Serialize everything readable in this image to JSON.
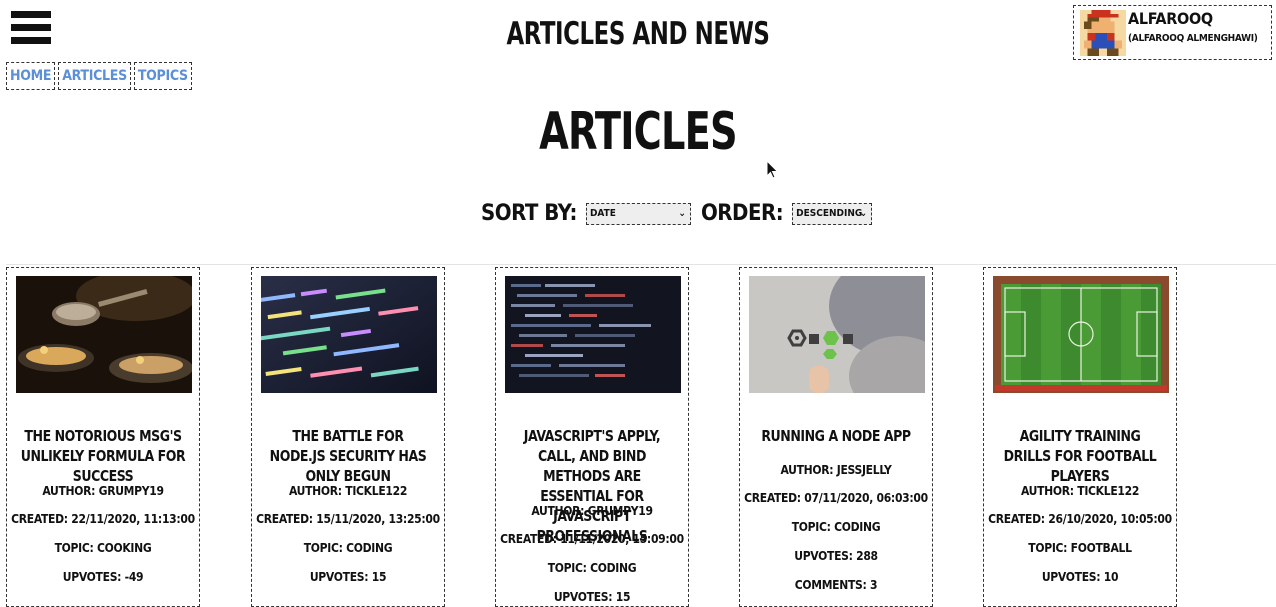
{
  "header": {
    "site_title": "ARTICLES AND NEWS"
  },
  "nav": [
    {
      "label": "HOME"
    },
    {
      "label": "ARTICLES"
    },
    {
      "label": "TOPICS"
    }
  ],
  "user": {
    "username": "ALFAROOQ",
    "full_name": "(ALFAROOQ ALMENGHAWI)",
    "avatar_icon": "pixel-mario-avatar"
  },
  "main": {
    "heading": "ARTICLES",
    "sort_label": "SORT BY:",
    "sort_value": "DATE",
    "order_label": "ORDER:",
    "order_value": "DESCENDING"
  },
  "articles": [
    {
      "title": "THE NOTORIOUS MSG'S UNLIKELY FORMULA FOR SUCCESS",
      "author": "AUTHOR: GRUMPY19",
      "created": "CREATED: 22/11/2020, 11:13:00",
      "topic": "TOPIC: COOKING",
      "upvotes": "UPVOTES: -49",
      "image": "cooking-pans-photo"
    },
    {
      "title": "THE BATTLE FOR NODE.JS SECURITY HAS ONLY BEGUN",
      "author": "AUTHOR: TICKLE122",
      "created": "CREATED: 15/11/2020, 13:25:00",
      "topic": "TOPIC: CODING",
      "upvotes": "UPVOTES: 15",
      "image": "code-screen-photo"
    },
    {
      "title": "JAVASCRIPT'S APPLY, CALL, AND BIND METHODS ARE ESSENTIAL FOR JAVASCRIPT PROFESSIONALS",
      "author": "AUTHOR: GRUMPY19",
      "created": "CREATED: 11/11/2020, 15:09:00",
      "topic": "TOPIC: CODING",
      "upvotes": "UPVOTES: 15",
      "image": "dark-code-photo"
    },
    {
      "title": "RUNNING A NODE APP",
      "author": "AUTHOR: JESSJELLY",
      "created": "CREATED: 07/11/2020, 06:03:00",
      "topic": "TOPIC: CODING",
      "upvotes": "UPVOTES: 288",
      "comments": "COMMENTS: 3",
      "image": "node-logo-photo"
    },
    {
      "title": "AGILITY TRAINING DRILLS FOR FOOTBALL PLAYERS",
      "author": "AUTHOR: TICKLE122",
      "created": "CREATED: 26/10/2020, 10:05:00",
      "topic": "TOPIC: FOOTBALL",
      "upvotes": "UPVOTES: 10",
      "image": "football-pitch-photo"
    }
  ],
  "colors": {
    "link": "#5b8fd6",
    "text": "#111111",
    "border": "#333333"
  }
}
